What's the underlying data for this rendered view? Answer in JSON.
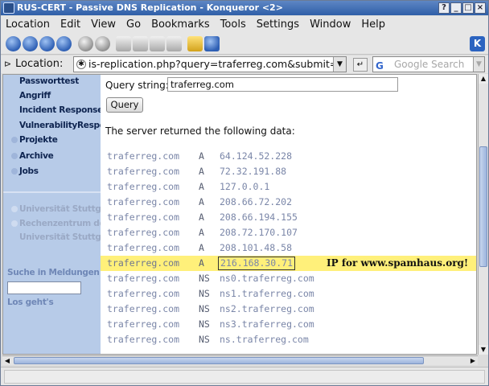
{
  "window": {
    "title": "RUS-CERT - Passive DNS Replication - Konqueror <2>",
    "controls": [
      "?",
      "_",
      "□",
      "×"
    ]
  },
  "menubar": [
    "Location",
    "Edit",
    "View",
    "Go",
    "Bookmarks",
    "Tools",
    "Settings",
    "Window",
    "Help"
  ],
  "locationbar": {
    "label": "Location:",
    "url": "is-replication.php?query=traferreg.com&submit=Query",
    "search_placeholder": "Google Search"
  },
  "sidebar": {
    "nav": [
      "Passworttest",
      "Angriff",
      "Incident Response",
      "VulnerabilityResponse",
      "Projekte",
      "Archive",
      "Jobs"
    ],
    "footer": [
      "Universität Stuttgart",
      "Rechenzentrum der",
      "Universität Stuttgart"
    ],
    "search_label": "Suche in Meldungen",
    "go_label": "Los geht's"
  },
  "content": {
    "query_label": "Query string:",
    "query_value": "traferreg.com",
    "query_button": "Query",
    "result_text": "The server returned the following data:",
    "records": [
      {
        "domain": "traferreg.com",
        "type": "A",
        "value": "64.124.52.228"
      },
      {
        "domain": "traferreg.com",
        "type": "A",
        "value": "72.32.191.88"
      },
      {
        "domain": "traferreg.com",
        "type": "A",
        "value": "127.0.0.1"
      },
      {
        "domain": "traferreg.com",
        "type": "A",
        "value": "208.66.72.202"
      },
      {
        "domain": "traferreg.com",
        "type": "A",
        "value": "208.66.194.155"
      },
      {
        "domain": "traferreg.com",
        "type": "A",
        "value": "208.72.170.107"
      },
      {
        "domain": "traferreg.com",
        "type": "A",
        "value": "208.101.48.58"
      },
      {
        "domain": "traferreg.com",
        "type": "A",
        "value": "216.168.30.71",
        "annotation": "IP for www.spamhaus.org!"
      },
      {
        "domain": "traferreg.com",
        "type": "NS",
        "value": "ns0.traferreg.com"
      },
      {
        "domain": "traferreg.com",
        "type": "NS",
        "value": "ns1.traferreg.com"
      },
      {
        "domain": "traferreg.com",
        "type": "NS",
        "value": "ns2.traferreg.com"
      },
      {
        "domain": "traferreg.com",
        "type": "NS",
        "value": "ns3.traferreg.com"
      },
      {
        "domain": "traferreg.com",
        "type": "NS",
        "value": "ns.traferreg.com"
      }
    ]
  },
  "colors": {
    "titlebar": "#2f5fa8",
    "sidebar": "#b7cbe8",
    "highlight": "#fff07a",
    "record_text": "#7a86a8"
  },
  "icons": [
    "back-icon",
    "forward-icon",
    "up-icon",
    "home-icon",
    "reload-icon",
    "stop-icon",
    "print-icon",
    "zoom-in-icon",
    "zoom-out-icon",
    "lock-icon",
    "download-icon",
    "kde-icon"
  ]
}
